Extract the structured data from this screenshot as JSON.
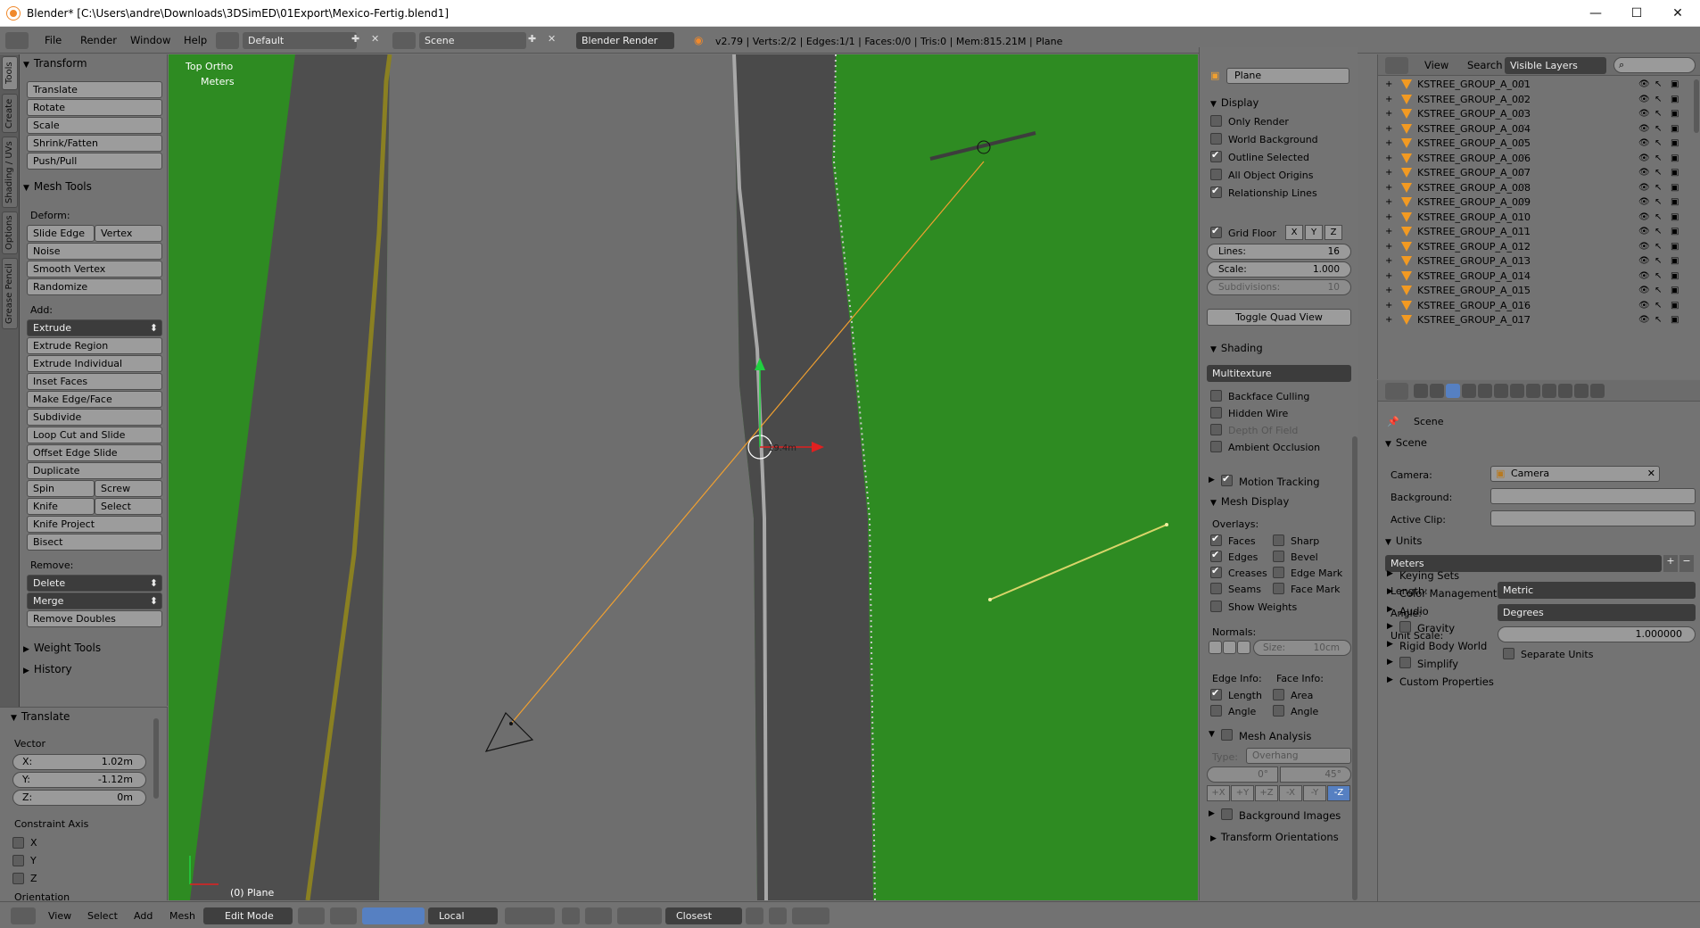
{
  "window": {
    "title": "Blender* [C:\\Users\\andre\\Downloads\\3DSimED\\01Export\\Mexico-Fertig.blend1]",
    "controls": [
      "—",
      "☐",
      "✕"
    ]
  },
  "topbar": {
    "menus": [
      "File",
      "Render",
      "Window",
      "Help"
    ],
    "layout": "Default",
    "scene": "Scene",
    "engine": "Blender Render",
    "stats": "v2.79 | Verts:2/2 | Edges:1/1 | Faces:0/0 | Tris:0 | Mem:815.21M | Plane"
  },
  "tool_tabs": [
    "Tools",
    "Create",
    "Shading / UVs",
    "Options",
    "Grease Pencil"
  ],
  "tools": {
    "transform_header": "Transform",
    "transform_buttons": [
      "Translate",
      "Rotate",
      "Scale",
      "Shrink/Fatten",
      "Push/Pull"
    ],
    "mesh_tools_header": "Mesh Tools",
    "deform_label": "Deform:",
    "slide_edge": "Slide Edge",
    "vertex": "Vertex",
    "noise": "Noise",
    "smooth_vertex": "Smooth Vertex",
    "randomize": "Randomize",
    "add_label": "Add:",
    "extrude": "Extrude",
    "add_buttons": [
      "Extrude Region",
      "Extrude Individual",
      "Inset Faces",
      "Make Edge/Face",
      "Subdivide",
      "Loop Cut and Slide",
      "Offset Edge Slide",
      "Duplicate"
    ],
    "spin": "Spin",
    "screw": "Screw",
    "knife": "Knife",
    "select": "Select",
    "knife_project": "Knife Project",
    "bisect": "Bisect",
    "remove_label": "Remove:",
    "delete": "Delete",
    "merge": "Merge",
    "remove_doubles": "Remove Doubles",
    "weight_tools": "Weight Tools",
    "history": "History"
  },
  "redo": {
    "header": "Translate",
    "vector_label": "Vector",
    "x": {
      "label": "X:",
      "value": "1.02m"
    },
    "y": {
      "label": "Y:",
      "value": "-1.12m"
    },
    "z": {
      "label": "Z:",
      "value": "0m"
    },
    "constraint_label": "Constraint Axis",
    "axes": [
      "X",
      "Y",
      "Z"
    ],
    "orientation_label": "Orientation"
  },
  "viewport": {
    "view_name": "Top Ortho",
    "units": "Meters",
    "object_label": "(0) Plane",
    "cursor_label": "19.4m",
    "colors": {
      "grass": "#2e8b22",
      "road": "#707070",
      "asphalt": "#4a4a4a",
      "line": "#f0a030"
    }
  },
  "npanel": {
    "object_name": "Plane",
    "display_header": "Display",
    "display_checks": [
      {
        "label": "Only Render",
        "on": false
      },
      {
        "label": "World Background",
        "on": false
      },
      {
        "label": "Outline Selected",
        "on": true
      },
      {
        "label": "All Object Origins",
        "on": false
      },
      {
        "label": "Relationship Lines",
        "on": true
      }
    ],
    "grid_floor": "Grid Floor",
    "axis_x": "X",
    "axis_y": "Y",
    "axis_z": "Z",
    "lines": {
      "label": "Lines:",
      "value": "16"
    },
    "scale": {
      "label": "Scale:",
      "value": "1.000"
    },
    "subdivisions": {
      "label": "Subdivisions:",
      "value": "10"
    },
    "toggle_quad": "Toggle Quad View",
    "shading_header": "Shading",
    "shading_mode": "Multitexture",
    "shading_checks": [
      {
        "label": "Backface Culling",
        "on": false,
        "dim": false
      },
      {
        "label": "Hidden Wire",
        "on": false,
        "dim": false
      },
      {
        "label": "Depth Of Field",
        "on": false,
        "dim": true
      },
      {
        "label": "Ambient Occlusion",
        "on": false,
        "dim": false
      }
    ],
    "motion_tracking": "Motion Tracking",
    "mesh_display_header": "Mesh Display",
    "overlays_label": "Overlays:",
    "overlays_left": [
      {
        "label": "Faces",
        "on": true
      },
      {
        "label": "Edges",
        "on": true
      },
      {
        "label": "Creases",
        "on": true
      },
      {
        "label": "Seams",
        "on": false
      }
    ],
    "overlays_right": [
      {
        "label": "Sharp",
        "on": false
      },
      {
        "label": "Bevel",
        "on": false
      },
      {
        "label": "Edge Mark",
        "on": false
      },
      {
        "label": "Face Mark",
        "on": false
      }
    ],
    "show_weights": "Show Weights",
    "normals_label": "Normals:",
    "normal_size": {
      "label": "Size:",
      "value": "10cm"
    },
    "edge_info_label": "Edge Info:",
    "face_info_label": "Face Info:",
    "edge_info": [
      {
        "label": "Length",
        "on": true
      },
      {
        "label": "Angle",
        "on": false
      }
    ],
    "face_info": [
      {
        "label": "Area",
        "on": false
      },
      {
        "label": "Angle",
        "on": false
      }
    ],
    "mesh_analysis": "Mesh Analysis",
    "type_label": "Type:",
    "type_value": "Overhang",
    "angle_min": "0°",
    "angle_max": "45°",
    "axis_buttons": [
      "+X",
      "+Y",
      "+Z",
      "-X",
      "-Y",
      "-Z"
    ],
    "background_images": "Background Images",
    "transform_orientations": "Transform Orientations"
  },
  "outliner": {
    "view": "View",
    "search": "Search",
    "filter": "Visible Layers",
    "items": [
      "KSTREE_GROUP_A_001",
      "KSTREE_GROUP_A_002",
      "KSTREE_GROUP_A_003",
      "KSTREE_GROUP_A_004",
      "KSTREE_GROUP_A_005",
      "KSTREE_GROUP_A_006",
      "KSTREE_GROUP_A_007",
      "KSTREE_GROUP_A_008",
      "KSTREE_GROUP_A_009",
      "KSTREE_GROUP_A_010",
      "KSTREE_GROUP_A_011",
      "KSTREE_GROUP_A_012",
      "KSTREE_GROUP_A_013",
      "KSTREE_GROUP_A_014",
      "KSTREE_GROUP_A_015",
      "KSTREE_GROUP_A_016",
      "KSTREE_GROUP_A_017"
    ]
  },
  "properties": {
    "breadcrumb": "Scene",
    "scene_header": "Scene",
    "camera_label": "Camera:",
    "camera_value": "Camera",
    "background_label": "Background:",
    "active_clip_label": "Active Clip:",
    "units_header": "Units",
    "units_preset": "Meters",
    "length_label": "Length:",
    "length_value": "Metric",
    "angle_label": "Angle:",
    "angle_value": "Degrees",
    "unit_scale_label": "Unit Scale:",
    "unit_scale_value": "1.000000",
    "separate_units": "Separate Units",
    "collapsed": [
      "Keying Sets",
      "Color Management",
      "Audio",
      "Gravity",
      "Rigid Body World",
      "Simplify",
      "Custom Properties"
    ]
  },
  "statusbar": {
    "menus": [
      "View",
      "Select",
      "Add",
      "Mesh"
    ],
    "mode": "Edit Mode",
    "orientation": "Local",
    "snap": "Closest"
  }
}
